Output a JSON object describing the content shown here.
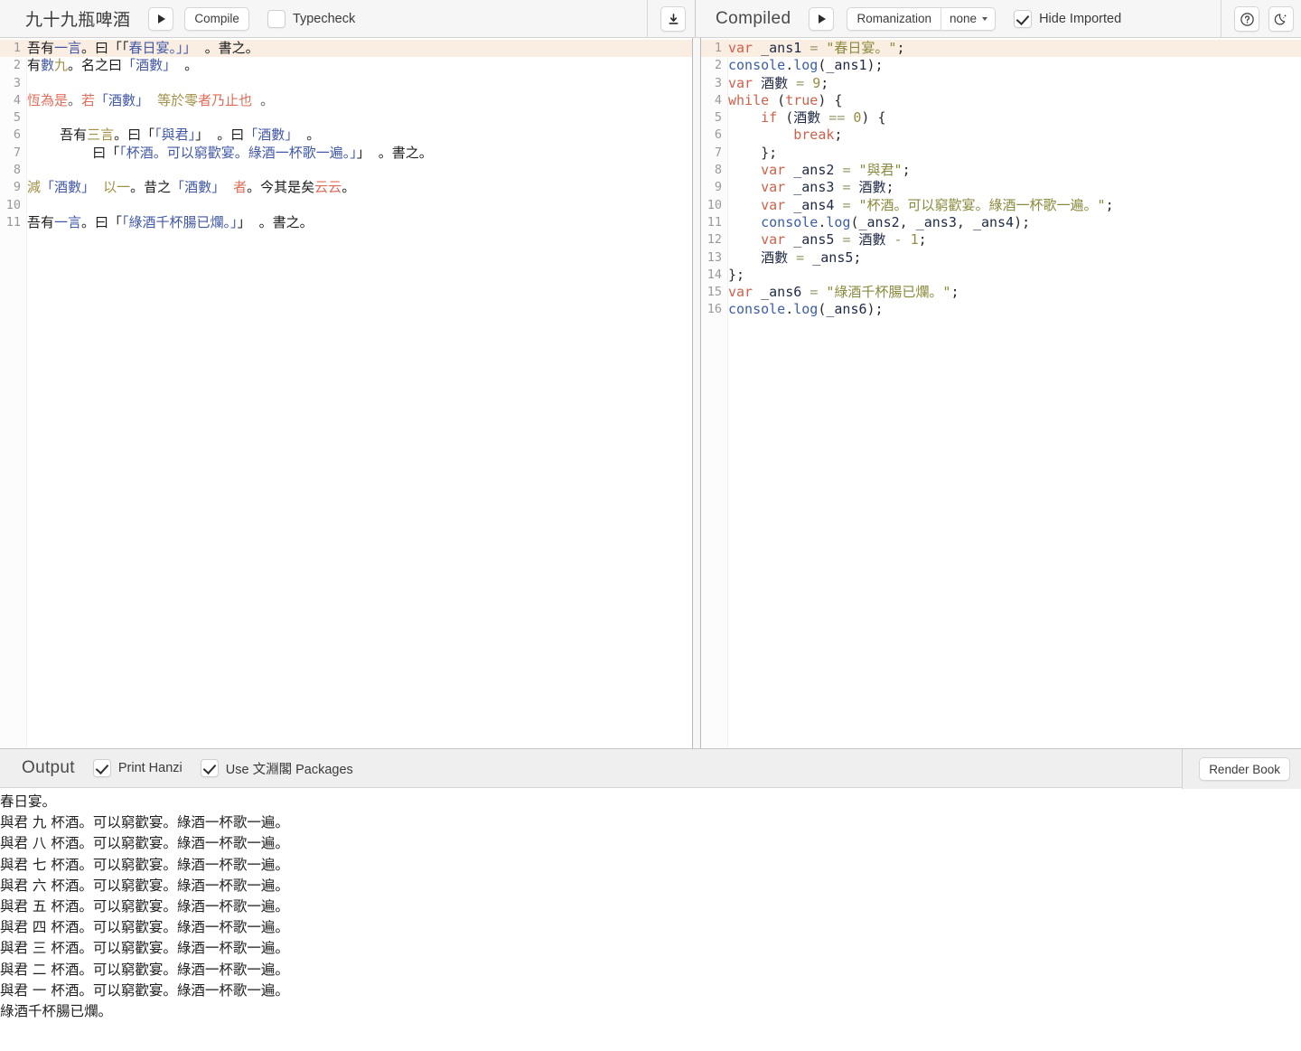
{
  "left_header": {
    "title": "九十九瓶啤酒",
    "run_icon": "play-icon",
    "compile_label": "Compile",
    "typecheck_label": "Typecheck",
    "typecheck_checked": false,
    "download_icon": "download-icon"
  },
  "right_header": {
    "title": "Compiled",
    "run_icon": "play-icon",
    "romanization_label": "Romanization",
    "romanization_value": "none",
    "hide_imported_label": "Hide Imported",
    "hide_imported_checked": true,
    "help_icon": "question-circle-icon",
    "darkmode_icon": "moon-icon"
  },
  "source_editor": {
    "active_line": 1,
    "lines": [
      {
        "n": "1",
        "tokens": [
          {
            "t": "吾有",
            "c": "w-plain"
          },
          {
            "t": "一言",
            "c": "w-blue"
          },
          {
            "t": "。曰「「",
            "c": "w-plain"
          },
          {
            "t": "春日宴。」」",
            "c": "w-blue"
          },
          {
            "t": " 。書之。",
            "c": "w-plain"
          }
        ]
      },
      {
        "n": "2",
        "tokens": [
          {
            "t": "有",
            "c": "w-plain"
          },
          {
            "t": "數",
            "c": "w-blue"
          },
          {
            "t": "九",
            "c": "w-olive"
          },
          {
            "t": "。名之曰",
            "c": "w-plain"
          },
          {
            "t": "「酒數」",
            "c": "w-blue"
          },
          {
            "t": " 。",
            "c": "w-plain"
          }
        ]
      },
      {
        "n": "3",
        "tokens": []
      },
      {
        "n": "4",
        "tokens": [
          {
            "t": "恆為是",
            "c": "w-red"
          },
          {
            "t": "。",
            "c": "w-punct"
          },
          {
            "t": "若",
            "c": "w-red"
          },
          {
            "t": "「酒數」",
            "c": "w-blue"
          },
          {
            "t": " ",
            "c": "w-plain"
          },
          {
            "t": "等於零",
            "c": "w-olive"
          },
          {
            "t": "者",
            "c": "w-red"
          },
          {
            "t": "乃止也",
            "c": "w-red"
          },
          {
            "t": " 。",
            "c": "w-punct"
          }
        ]
      },
      {
        "n": "5",
        "tokens": []
      },
      {
        "n": "6",
        "tokens": [
          {
            "t": "    吾有",
            "c": "w-plain"
          },
          {
            "t": "三言",
            "c": "w-olive"
          },
          {
            "t": "。曰「",
            "c": "w-plain"
          },
          {
            "t": "「與君」",
            "c": "w-blue"
          },
          {
            "t": "」 。曰",
            "c": "w-plain"
          },
          {
            "t": "「酒數」",
            "c": "w-blue"
          },
          {
            "t": " 。",
            "c": "w-plain"
          }
        ]
      },
      {
        "n": "7",
        "tokens": [
          {
            "t": "        曰「",
            "c": "w-plain"
          },
          {
            "t": "「杯酒。可以窮歡宴。綠酒一杯歌一遍。」",
            "c": "w-blue"
          },
          {
            "t": "」 。書之。",
            "c": "w-plain"
          }
        ]
      },
      {
        "n": "8",
        "tokens": []
      },
      {
        "n": "9",
        "tokens": [
          {
            "t": "減",
            "c": "w-olive"
          },
          {
            "t": "「酒數」",
            "c": "w-blue"
          },
          {
            "t": " ",
            "c": "w-plain"
          },
          {
            "t": "以一",
            "c": "w-olive"
          },
          {
            "t": "。昔之",
            "c": "w-plain"
          },
          {
            "t": "「酒數」",
            "c": "w-blue"
          },
          {
            "t": " ",
            "c": "w-plain"
          },
          {
            "t": "者",
            "c": "w-red"
          },
          {
            "t": "。今其是矣",
            "c": "w-plain"
          },
          {
            "t": "云云",
            "c": "w-red"
          },
          {
            "t": "。",
            "c": "w-plain"
          }
        ]
      },
      {
        "n": "10",
        "tokens": []
      },
      {
        "n": "11",
        "tokens": [
          {
            "t": "吾有",
            "c": "w-plain"
          },
          {
            "t": "一言",
            "c": "w-blue"
          },
          {
            "t": "。曰「",
            "c": "w-plain"
          },
          {
            "t": "「綠酒千杯腸已爛。」",
            "c": "w-blue"
          },
          {
            "t": "」 。書之。",
            "c": "w-plain"
          }
        ]
      }
    ]
  },
  "compiled_editor": {
    "active_line": 1,
    "lines": [
      {
        "n": "1",
        "tokens": [
          {
            "t": "var",
            "c": "j-kw"
          },
          {
            "t": " ",
            "c": "j-plain"
          },
          {
            "t": "_ans1",
            "c": "j-var"
          },
          {
            "t": " ",
            "c": "j-plain"
          },
          {
            "t": "=",
            "c": "j-op"
          },
          {
            "t": " ",
            "c": "j-plain"
          },
          {
            "t": "\"春日宴。\"",
            "c": "j-str"
          },
          {
            "t": ";",
            "c": "j-plain"
          }
        ]
      },
      {
        "n": "2",
        "tokens": [
          {
            "t": "console",
            "c": "j-fn"
          },
          {
            "t": ".",
            "c": "j-plain"
          },
          {
            "t": "log",
            "c": "j-fn"
          },
          {
            "t": "(",
            "c": "j-plain"
          },
          {
            "t": "_ans1",
            "c": "j-var"
          },
          {
            "t": ");",
            "c": "j-plain"
          }
        ]
      },
      {
        "n": "3",
        "tokens": [
          {
            "t": "var",
            "c": "j-kw"
          },
          {
            "t": " ",
            "c": "j-plain"
          },
          {
            "t": "酒數",
            "c": "j-han"
          },
          {
            "t": " ",
            "c": "j-plain"
          },
          {
            "t": "=",
            "c": "j-op"
          },
          {
            "t": " ",
            "c": "j-plain"
          },
          {
            "t": "9",
            "c": "j-num"
          },
          {
            "t": ";",
            "c": "j-plain"
          }
        ]
      },
      {
        "n": "4",
        "tokens": [
          {
            "t": "while",
            "c": "j-kw"
          },
          {
            "t": " (",
            "c": "j-plain"
          },
          {
            "t": "true",
            "c": "j-kw"
          },
          {
            "t": ") {",
            "c": "j-plain"
          }
        ]
      },
      {
        "n": "5",
        "tokens": [
          {
            "t": "    ",
            "c": "j-plain"
          },
          {
            "t": "if",
            "c": "j-kw"
          },
          {
            "t": " (",
            "c": "j-plain"
          },
          {
            "t": "酒數",
            "c": "j-han"
          },
          {
            "t": " ",
            "c": "j-plain"
          },
          {
            "t": "==",
            "c": "j-op"
          },
          {
            "t": " ",
            "c": "j-plain"
          },
          {
            "t": "0",
            "c": "j-num"
          },
          {
            "t": ") {",
            "c": "j-plain"
          }
        ]
      },
      {
        "n": "6",
        "tokens": [
          {
            "t": "        ",
            "c": "j-plain"
          },
          {
            "t": "break",
            "c": "j-kw"
          },
          {
            "t": ";",
            "c": "j-plain"
          }
        ]
      },
      {
        "n": "7",
        "tokens": [
          {
            "t": "    };",
            "c": "j-plain"
          }
        ]
      },
      {
        "n": "8",
        "tokens": [
          {
            "t": "    ",
            "c": "j-plain"
          },
          {
            "t": "var",
            "c": "j-kw"
          },
          {
            "t": " ",
            "c": "j-plain"
          },
          {
            "t": "_ans2",
            "c": "j-var"
          },
          {
            "t": " ",
            "c": "j-plain"
          },
          {
            "t": "=",
            "c": "j-op"
          },
          {
            "t": " ",
            "c": "j-plain"
          },
          {
            "t": "\"與君\"",
            "c": "j-str"
          },
          {
            "t": ";",
            "c": "j-plain"
          }
        ]
      },
      {
        "n": "9",
        "tokens": [
          {
            "t": "    ",
            "c": "j-plain"
          },
          {
            "t": "var",
            "c": "j-kw"
          },
          {
            "t": " ",
            "c": "j-plain"
          },
          {
            "t": "_ans3",
            "c": "j-var"
          },
          {
            "t": " ",
            "c": "j-plain"
          },
          {
            "t": "=",
            "c": "j-op"
          },
          {
            "t": " ",
            "c": "j-plain"
          },
          {
            "t": "酒數",
            "c": "j-han"
          },
          {
            "t": ";",
            "c": "j-plain"
          }
        ]
      },
      {
        "n": "10",
        "tokens": [
          {
            "t": "    ",
            "c": "j-plain"
          },
          {
            "t": "var",
            "c": "j-kw"
          },
          {
            "t": " ",
            "c": "j-plain"
          },
          {
            "t": "_ans4",
            "c": "j-var"
          },
          {
            "t": " ",
            "c": "j-plain"
          },
          {
            "t": "=",
            "c": "j-op"
          },
          {
            "t": " ",
            "c": "j-plain"
          },
          {
            "t": "\"杯酒。可以窮歡宴。綠酒一杯歌一遍。\"",
            "c": "j-str"
          },
          {
            "t": ";",
            "c": "j-plain"
          }
        ]
      },
      {
        "n": "11",
        "tokens": [
          {
            "t": "    ",
            "c": "j-plain"
          },
          {
            "t": "console",
            "c": "j-fn"
          },
          {
            "t": ".",
            "c": "j-plain"
          },
          {
            "t": "log",
            "c": "j-fn"
          },
          {
            "t": "(",
            "c": "j-plain"
          },
          {
            "t": "_ans2",
            "c": "j-var"
          },
          {
            "t": ", ",
            "c": "j-plain"
          },
          {
            "t": "_ans3",
            "c": "j-var"
          },
          {
            "t": ", ",
            "c": "j-plain"
          },
          {
            "t": "_ans4",
            "c": "j-var"
          },
          {
            "t": ");",
            "c": "j-plain"
          }
        ]
      },
      {
        "n": "12",
        "tokens": [
          {
            "t": "    ",
            "c": "j-plain"
          },
          {
            "t": "var",
            "c": "j-kw"
          },
          {
            "t": " ",
            "c": "j-plain"
          },
          {
            "t": "_ans5",
            "c": "j-var"
          },
          {
            "t": " ",
            "c": "j-plain"
          },
          {
            "t": "=",
            "c": "j-op"
          },
          {
            "t": " ",
            "c": "j-plain"
          },
          {
            "t": "酒數",
            "c": "j-han"
          },
          {
            "t": " ",
            "c": "j-plain"
          },
          {
            "t": "-",
            "c": "j-op"
          },
          {
            "t": " ",
            "c": "j-plain"
          },
          {
            "t": "1",
            "c": "j-num"
          },
          {
            "t": ";",
            "c": "j-plain"
          }
        ]
      },
      {
        "n": "13",
        "tokens": [
          {
            "t": "    ",
            "c": "j-plain"
          },
          {
            "t": "酒數",
            "c": "j-han"
          },
          {
            "t": " ",
            "c": "j-plain"
          },
          {
            "t": "=",
            "c": "j-op"
          },
          {
            "t": " ",
            "c": "j-plain"
          },
          {
            "t": "_ans5",
            "c": "j-var"
          },
          {
            "t": ";",
            "c": "j-plain"
          }
        ]
      },
      {
        "n": "14",
        "tokens": [
          {
            "t": "};",
            "c": "j-plain"
          }
        ]
      },
      {
        "n": "15",
        "tokens": [
          {
            "t": "var",
            "c": "j-kw"
          },
          {
            "t": " ",
            "c": "j-plain"
          },
          {
            "t": "_ans6",
            "c": "j-var"
          },
          {
            "t": " ",
            "c": "j-plain"
          },
          {
            "t": "=",
            "c": "j-op"
          },
          {
            "t": " ",
            "c": "j-plain"
          },
          {
            "t": "\"綠酒千杯腸已爛。\"",
            "c": "j-str"
          },
          {
            "t": ";",
            "c": "j-plain"
          }
        ]
      },
      {
        "n": "16",
        "tokens": [
          {
            "t": "console",
            "c": "j-fn"
          },
          {
            "t": ".",
            "c": "j-plain"
          },
          {
            "t": "log",
            "c": "j-fn"
          },
          {
            "t": "(",
            "c": "j-plain"
          },
          {
            "t": "_ans6",
            "c": "j-var"
          },
          {
            "t": ");",
            "c": "j-plain"
          }
        ]
      }
    ]
  },
  "output_bar": {
    "title": "Output",
    "print_hanzi_label": "Print Hanzi",
    "print_hanzi_checked": true,
    "use_packages_label": "Use 文淵閣 Packages",
    "use_packages_checked": true,
    "render_book_label": "Render Book"
  },
  "output_text": [
    "春日宴。",
    "與君 九 杯酒。可以窮歡宴。綠酒一杯歌一遍。",
    "與君 八 杯酒。可以窮歡宴。綠酒一杯歌一遍。",
    "與君 七 杯酒。可以窮歡宴。綠酒一杯歌一遍。",
    "與君 六 杯酒。可以窮歡宴。綠酒一杯歌一遍。",
    "與君 五 杯酒。可以窮歡宴。綠酒一杯歌一遍。",
    "與君 四 杯酒。可以窮歡宴。綠酒一杯歌一遍。",
    "與君 三 杯酒。可以窮歡宴。綠酒一杯歌一遍。",
    "與君 二 杯酒。可以窮歡宴。綠酒一杯歌一遍。",
    "與君 一 杯酒。可以窮歡宴。綠酒一杯歌一遍。",
    "綠酒千杯腸已爛。"
  ]
}
